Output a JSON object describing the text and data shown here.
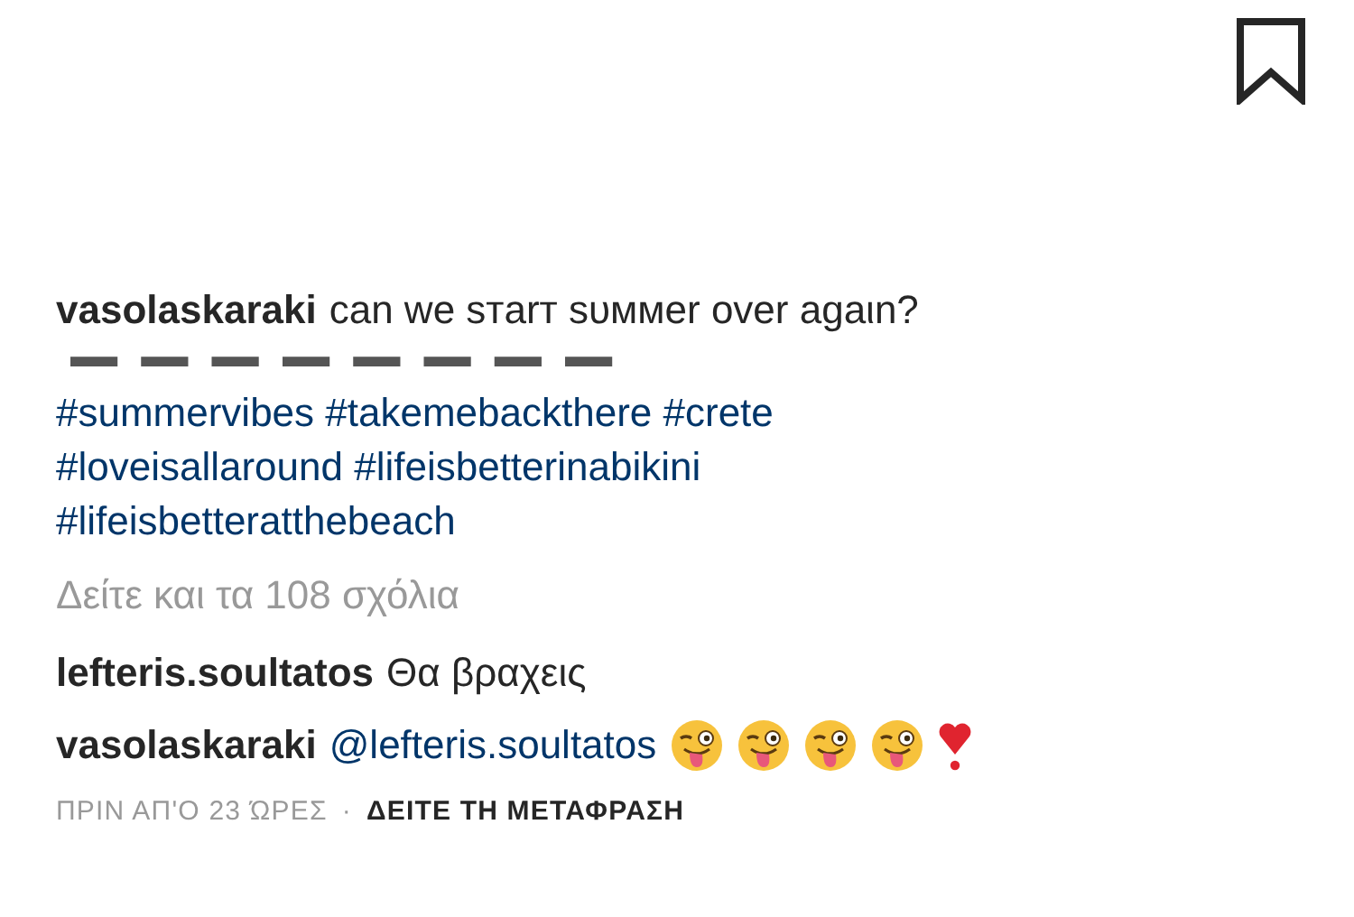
{
  "caption": {
    "username": "vasolaskaraki",
    "text": "can we sтarт sυммer over agaιn?",
    "divider": "▬ ▬ ▬ ▬ ▬ ▬ ▬ ▬",
    "hashtag_lines": [
      "#summervibes #takemebackthere #crete",
      "#loveisallaround #lifeisbetterinabikini",
      "#lifeisbetteratthebeach"
    ]
  },
  "view_comments": "Δείτε και τα 108 σχόλια",
  "comments": [
    {
      "username": "lefteris.soultatos",
      "text": "Θα βραχεις"
    },
    {
      "username": "vasolaskaraki",
      "mention": "@lefteris.soultatos"
    }
  ],
  "footer": {
    "time": "ΠΡΙΝ ΑΠ'Ο 23 ΏΡΕΣ",
    "separator": "·",
    "translate": "ΔΕΙΤΕ ΤΗ ΜΕΤΑΦΡΑΣΗ"
  }
}
